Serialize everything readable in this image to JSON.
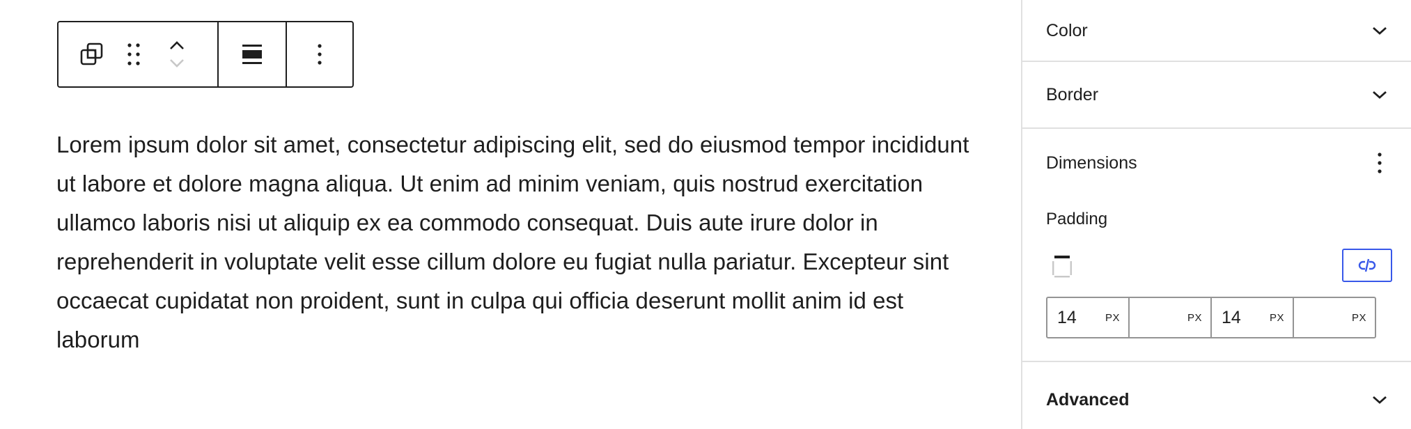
{
  "toolbar": {
    "icons": [
      "block-transform-icon",
      "drag-handle-icon",
      "move-up-icon",
      "move-down-icon",
      "align-full-icon",
      "more-options-icon"
    ]
  },
  "paragraph": {
    "text": "Lorem ipsum dolor sit amet, consectetur adipiscing elit, sed do eiusmod tempor incididunt ut labore et dolore magna aliqua. Ut enim ad minim veniam, quis nostrud exercitation ullamco laboris nisi ut aliquip ex ea commodo consequat. Duis aute irure dolor in reprehenderit in voluptate velit esse cillum dolore eu fugiat nulla pariatur. Excepteur sint occaecat cupidatat non proident, sunt in culpa qui officia deserunt mollit anim id est laborum"
  },
  "sidebar": {
    "panels": {
      "color": {
        "title": "Color"
      },
      "border": {
        "title": "Border"
      },
      "dimensions": {
        "title": "Dimensions",
        "padding": {
          "label": "Padding",
          "fields": [
            {
              "value": "14",
              "unit": "PX"
            },
            {
              "value": "",
              "unit": "PX"
            },
            {
              "value": "14",
              "unit": "PX"
            },
            {
              "value": "",
              "unit": "PX"
            }
          ]
        }
      },
      "advanced": {
        "title": "Advanced"
      }
    }
  },
  "colors": {
    "text": "#1e1e1e",
    "divider": "#e0e0e0",
    "input_border": "#949494",
    "accent": "#3858e9",
    "disabled_icon": "#c8c8c8"
  }
}
